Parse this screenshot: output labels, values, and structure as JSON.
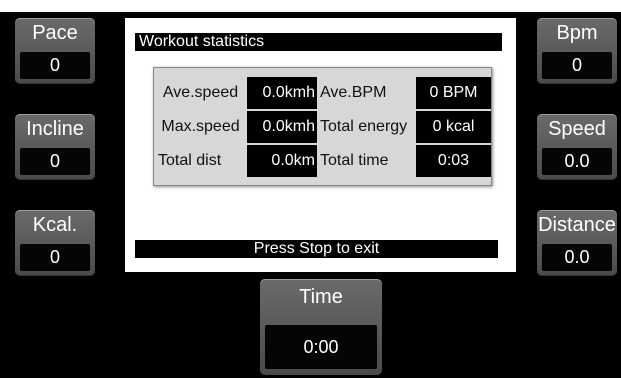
{
  "left_tiles": [
    {
      "label": "Pace",
      "value": "0"
    },
    {
      "label": "Incline",
      "value": "0"
    },
    {
      "label": "Kcal.",
      "value": "0"
    }
  ],
  "right_tiles": [
    {
      "label": "Bpm",
      "value": "0"
    },
    {
      "label": "Speed",
      "value": "0.0"
    },
    {
      "label": "Distance",
      "value": "0.0"
    }
  ],
  "time_tile": {
    "label": "Time",
    "value": "0:00"
  },
  "panel": {
    "title": "Workout statistics",
    "rows": [
      {
        "label1": "Ave.speed",
        "value1": "0.0kmh",
        "label2": "Ave.BPM",
        "value2": "0 BPM"
      },
      {
        "label1": "Max.speed",
        "value1": "0.0kmh",
        "label2": "Total energy",
        "value2": "0 kcal"
      },
      {
        "label1": "Total dist",
        "value1": "0.0km",
        "label2": "Total time",
        "value2": "0:03"
      }
    ],
    "exit_message": "Press Stop to exit"
  },
  "colors": {
    "screen_bg": "#000000",
    "tile_bg": "#5a5a5a",
    "panel_bg": "#ffffff"
  }
}
